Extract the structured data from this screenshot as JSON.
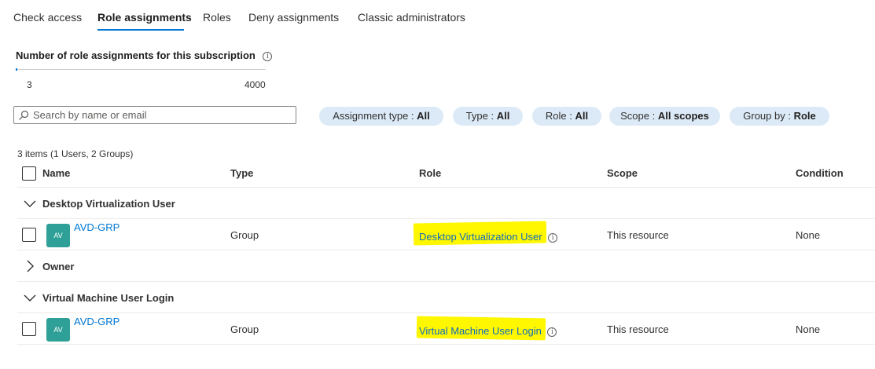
{
  "tabs": [
    {
      "label": "Check access"
    },
    {
      "label": "Role assignments"
    },
    {
      "label": "Roles"
    },
    {
      "label": "Deny assignments"
    },
    {
      "label": "Classic administrators"
    }
  ],
  "active_tab": "Role assignments",
  "counter": {
    "title": "Number of role assignments for this subscription",
    "current": "3",
    "max": "4000",
    "fraction": 0.00075
  },
  "search": {
    "placeholder": "Search by name or email",
    "value": ""
  },
  "filters": [
    {
      "key": "Assignment type",
      "value": "All"
    },
    {
      "key": "Type",
      "value": "All"
    },
    {
      "key": "Role",
      "value": "All"
    },
    {
      "key": "Scope",
      "value": "All scopes"
    },
    {
      "key": "Group by",
      "value": "Role"
    }
  ],
  "table": {
    "items_count": "3 items (1 Users, 2 Groups)",
    "columns": [
      "Name",
      "Type",
      "Role",
      "Scope",
      "Condition"
    ],
    "groups": [
      {
        "label": "Desktop Virtualization User",
        "expanded": true,
        "rows": [
          {
            "initials": "AV",
            "name": "AVD-GRP",
            "type": "Group",
            "role": "Desktop Virtualization User",
            "scope": "This resource",
            "condition": "None"
          }
        ]
      },
      {
        "label": "Owner",
        "expanded": false,
        "rows": []
      },
      {
        "label": "Virtual Machine User Login",
        "expanded": true,
        "rows": [
          {
            "initials": "AV",
            "name": "AVD-GRP",
            "type": "Group",
            "role": "Virtual Machine User Login",
            "scope": "This resource",
            "condition": "None"
          }
        ]
      }
    ]
  },
  "colors": {
    "accent": "#0078d4",
    "pill_bg": "#dceaf7",
    "avatar_bg": "#2ea097",
    "highlight": "#fff700"
  },
  "icons": {
    "info": "info-icon",
    "search": "search-icon",
    "expand": "chevron-down-icon",
    "collapse": "chevron-right-icon"
  }
}
